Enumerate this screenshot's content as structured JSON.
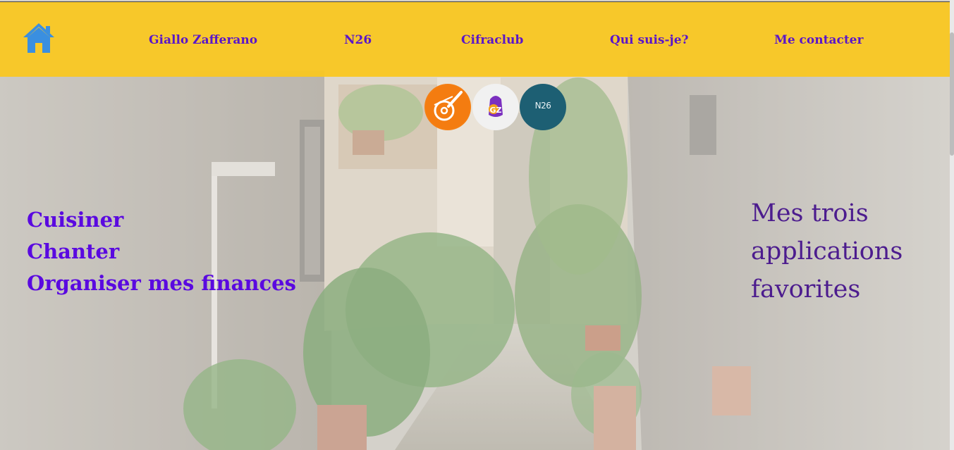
{
  "header": {
    "home_icon": "home-icon",
    "nav": [
      {
        "label": "Giallo Zafferano"
      },
      {
        "label": "N26"
      },
      {
        "label": "Cifraclub"
      },
      {
        "label": "Qui suis-je?"
      },
      {
        "label": "Me contacter"
      }
    ]
  },
  "apps": {
    "cifraclub_icon": "guitar-icon",
    "giallo_icon": "gz-logo",
    "n26_label": "N26"
  },
  "activities": [
    "Cuisiner",
    "Chanter",
    "Organiser mes finances"
  ],
  "favorites_heading": "Mes trois applications favorites",
  "colors": {
    "navbar": "#fac71e",
    "nav_text": "#5a16c9",
    "activity_text": "#5a09e0",
    "heading_text": "#4c1c8e",
    "home_icon": "#3a8fe0"
  }
}
